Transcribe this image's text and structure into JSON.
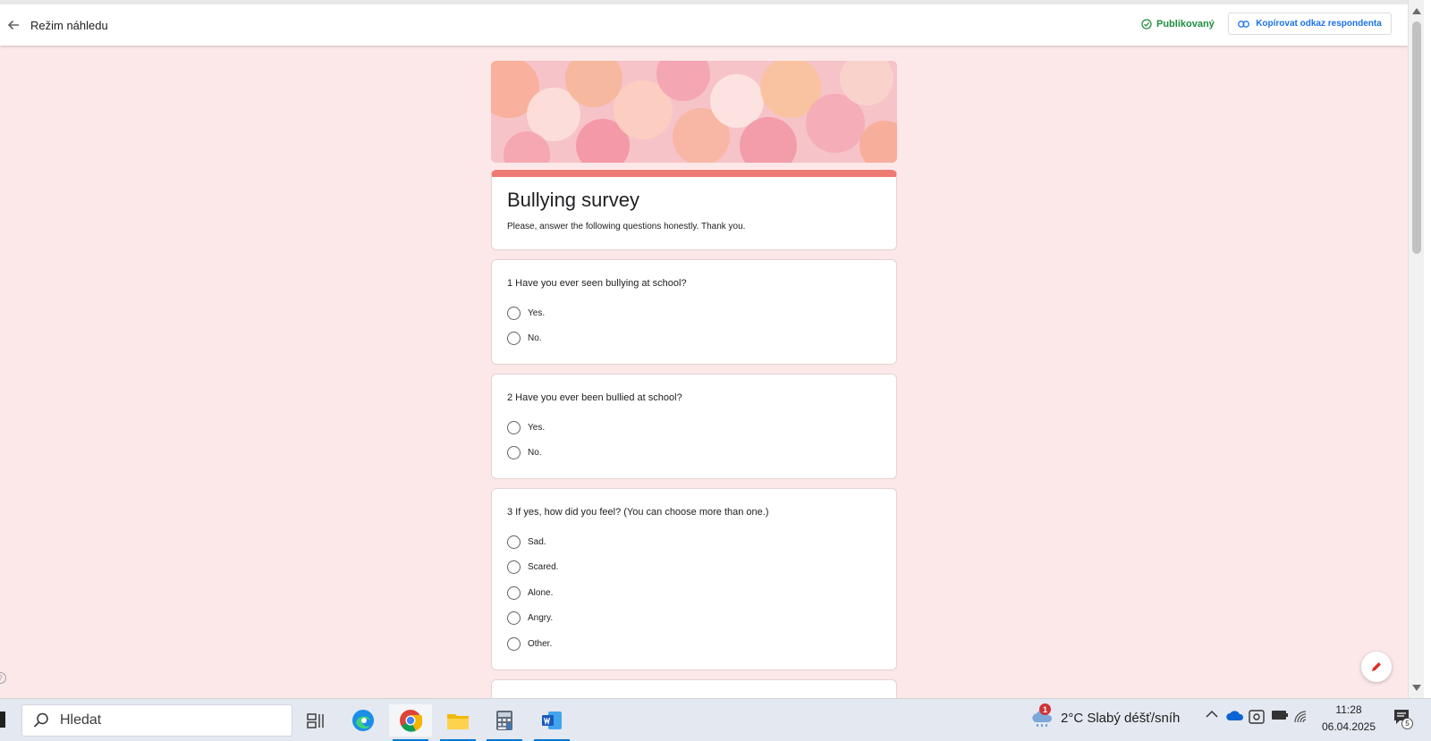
{
  "topbar": {
    "title": "Režim náhledu",
    "status_label": "Publikovaný",
    "copy_link_label": "Kopírovat odkaz respondenta"
  },
  "form": {
    "title": "Bullying survey",
    "description": "Please, answer the following questions honestly. Thank you.",
    "questions": [
      {
        "text": "1 Have you ever seen bullying at school?",
        "options": [
          "Yes.",
          "No."
        ]
      },
      {
        "text": "2 Have you ever been bullied at school?",
        "options": [
          "Yes.",
          "No."
        ]
      },
      {
        "text": "3 If yes, how did you feel? (You can choose more than one.)",
        "options": [
          "Sad.",
          "Scared.",
          "Alone.",
          "Angry.",
          "Other."
        ]
      }
    ]
  },
  "taskbar": {
    "search_placeholder": "Hledat",
    "weather_text": "2°C  Slabý déšť/sníh",
    "weather_alert_count": "1",
    "time": "11:28",
    "date": "06.04.2025",
    "notification_count": "5",
    "apps": [
      "task-view",
      "edge",
      "chrome",
      "file-explorer",
      "calculator",
      "word"
    ]
  },
  "colors": {
    "page_background": "#fce8e8",
    "accent": "#ee7b73",
    "published_green": "#1e8e3e",
    "link_blue": "#1a73e8"
  }
}
